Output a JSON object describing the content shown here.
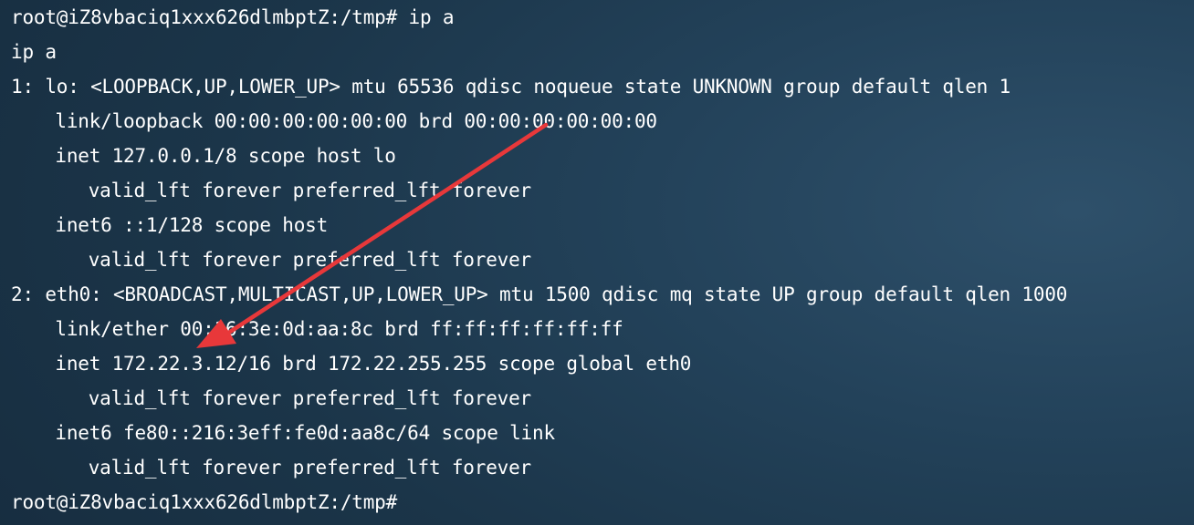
{
  "terminal": {
    "lines": [
      {
        "indent": 0,
        "text": "root@iZ8vbaciq1xxx626dlmbptZ:/tmp# ip a"
      },
      {
        "indent": 0,
        "text": "ip a"
      },
      {
        "indent": 0,
        "text": "1: lo: <LOOPBACK,UP,LOWER_UP> mtu 65536 qdisc noqueue state UNKNOWN group default qlen 1"
      },
      {
        "indent": 4,
        "text": "link/loopback 00:00:00:00:00:00 brd 00:00:00:00:00:00"
      },
      {
        "indent": 4,
        "text": "inet 127.0.0.1/8 scope host lo"
      },
      {
        "indent": 7,
        "text": "valid_lft forever preferred_lft forever"
      },
      {
        "indent": 4,
        "text": "inet6 ::1/128 scope host"
      },
      {
        "indent": 7,
        "text": "valid_lft forever preferred_lft forever"
      },
      {
        "indent": 0,
        "text": "2: eth0: <BROADCAST,MULTICAST,UP,LOWER_UP> mtu 1500 qdisc mq state UP group default qlen 1000"
      },
      {
        "indent": 4,
        "text": "link/ether 00:16:3e:0d:aa:8c brd ff:ff:ff:ff:ff:ff"
      },
      {
        "indent": 4,
        "text": "inet 172.22.3.12/16 brd 172.22.255.255 scope global eth0"
      },
      {
        "indent": 7,
        "text": "valid_lft forever preferred_lft forever"
      },
      {
        "indent": 4,
        "text": "inet6 fe80::216:3eff:fe0d:aa8c/64 scope link"
      },
      {
        "indent": 7,
        "text": "valid_lft forever preferred_lft forever"
      },
      {
        "indent": 0,
        "text": "root@iZ8vbaciq1xxx626dlmbptZ:/tmp#"
      }
    ]
  },
  "annotation": {
    "icon": "red-arrow-icon",
    "color": "#e8383a"
  }
}
